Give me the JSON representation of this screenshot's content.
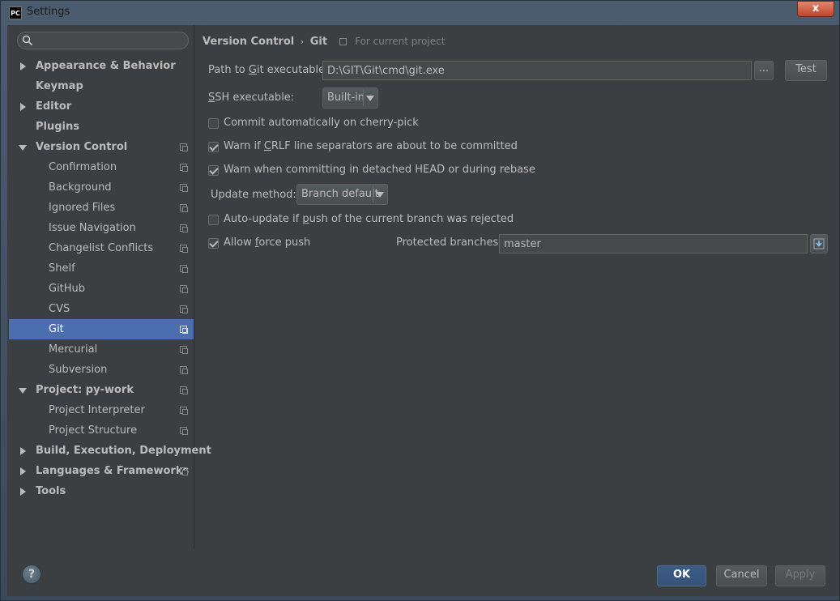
{
  "window": {
    "title": "Settings",
    "app_icon": "PC",
    "close_label": "x"
  },
  "search": {
    "placeholder": "",
    "value": ""
  },
  "sidebar": {
    "items": [
      {
        "label": "Appearance & Behavior",
        "level": 1,
        "expander": "collapsed",
        "bold": true,
        "project_icon": false
      },
      {
        "label": "Keymap",
        "level": 1,
        "expander": "none",
        "bold": true,
        "project_icon": false
      },
      {
        "label": "Editor",
        "level": 1,
        "expander": "collapsed",
        "bold": true,
        "project_icon": false
      },
      {
        "label": "Plugins",
        "level": 1,
        "expander": "none",
        "bold": true,
        "project_icon": false
      },
      {
        "label": "Version Control",
        "level": 1,
        "expander": "expanded",
        "bold": true,
        "project_icon": true
      },
      {
        "label": "Confirmation",
        "level": 2,
        "project_icon": true
      },
      {
        "label": "Background",
        "level": 2,
        "project_icon": true
      },
      {
        "label": "Ignored Files",
        "level": 2,
        "project_icon": true
      },
      {
        "label": "Issue Navigation",
        "level": 2,
        "project_icon": true
      },
      {
        "label": "Changelist Conflicts",
        "level": 2,
        "project_icon": true
      },
      {
        "label": "Shelf",
        "level": 2,
        "project_icon": true
      },
      {
        "label": "GitHub",
        "level": 2,
        "project_icon": true
      },
      {
        "label": "CVS",
        "level": 2,
        "project_icon": true
      },
      {
        "label": "Git",
        "level": 2,
        "project_icon": true,
        "selected": true
      },
      {
        "label": "Mercurial",
        "level": 2,
        "project_icon": true
      },
      {
        "label": "Subversion",
        "level": 2,
        "project_icon": true
      },
      {
        "label": "Project: py-work",
        "level": 1,
        "expander": "expanded",
        "bold": true,
        "project_icon": true
      },
      {
        "label": "Project Interpreter",
        "level": 2,
        "project_icon": true
      },
      {
        "label": "Project Structure",
        "level": 2,
        "project_icon": true
      },
      {
        "label": "Build, Execution, Deployment",
        "level": 1,
        "expander": "collapsed",
        "bold": true,
        "project_icon": false
      },
      {
        "label": "Languages & Frameworks",
        "level": 1,
        "expander": "collapsed",
        "bold": true,
        "project_icon": true
      },
      {
        "label": "Tools",
        "level": 1,
        "expander": "collapsed",
        "bold": true,
        "project_icon": false
      }
    ]
  },
  "breadcrumb": {
    "parent": "Version Control",
    "separator": "›",
    "current": "Git",
    "scope": "For current project"
  },
  "git": {
    "path_label_pre": "Path to ",
    "path_label_u": "G",
    "path_label_post": "it executable:",
    "path_value": "D:\\GIT\\Git\\cmd\\git.exe",
    "browse_label": "...",
    "test_label": "Test",
    "ssh_label_u": "S",
    "ssh_label_post": "SH executable:",
    "ssh_value": "Built-in",
    "commit_cherry_pick": {
      "label": "Commit automatically on cherry-pick",
      "checked": false
    },
    "warn_crlf": {
      "pre": "Warn if ",
      "u": "C",
      "post": "RLF line separators are about to be committed",
      "checked": true
    },
    "warn_detached": {
      "label": "Warn when committing in detached HEAD or during rebase",
      "checked": true
    },
    "update_method_label": "Update method:",
    "update_method_value": "Branch default",
    "auto_update": {
      "pre": "Auto-update if ",
      "u": "p",
      "post": "ush of the current branch was rejected",
      "checked": false
    },
    "allow_force_push": {
      "pre": "Allow ",
      "u": "f",
      "post": "orce push",
      "checked": true
    },
    "protected_branches_label": "Protected branches:",
    "protected_branches_value": "master"
  },
  "footer": {
    "help_label": "?",
    "ok_label": "OK",
    "cancel_label": "Cancel",
    "apply_label": "Apply"
  },
  "colors": {
    "selection": "#4b6eaf",
    "background": "#3c3f41",
    "text": "#bbbbbb"
  }
}
